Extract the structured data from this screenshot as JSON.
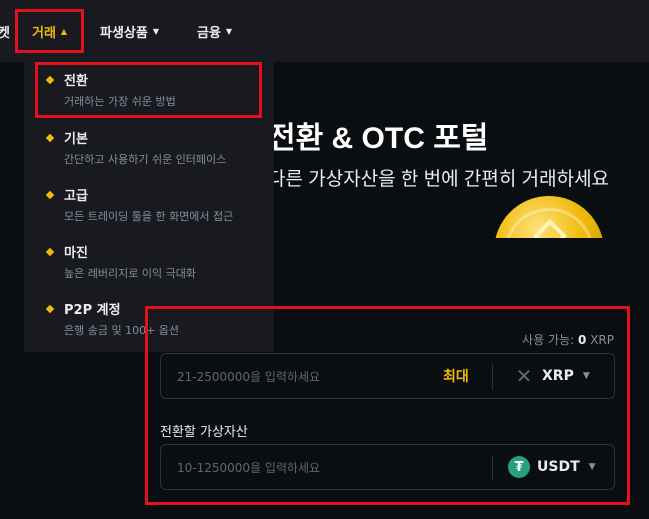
{
  "nav": {
    "fragment": "켓",
    "items": [
      {
        "label": "거래",
        "caret": "▲"
      },
      {
        "label": "파생상품",
        "caret": "▼"
      },
      {
        "label": "금융",
        "caret": "▼"
      }
    ]
  },
  "menu": {
    "items": [
      {
        "title": "전환",
        "subtitle": "거래하는 가장 쉬운 방법"
      },
      {
        "title": "기본",
        "subtitle": "간단하고 사용하기 쉬운 인터페이스"
      },
      {
        "title": "고급",
        "subtitle": "모든 트레이딩 툴을 한 화면에서 접근"
      },
      {
        "title": "마진",
        "subtitle": "높은 레버리지로 이익 극대화"
      },
      {
        "title": "P2P 계정",
        "subtitle": "은행 송금 및 100+ 옵션"
      }
    ]
  },
  "hero": {
    "title": "전환 & OTC 포털",
    "subtitle": "다른 가상자산을 한 번에 간편히 거래하세요"
  },
  "convert": {
    "available_label": "사용 가능:",
    "available_value": "0",
    "available_unit": "XRP",
    "from": {
      "placeholder": "21-2500000을 입력하세요",
      "max_label": "최대",
      "asset": "XRP",
      "asset_icon": "xrp-icon"
    },
    "to_label": "전환할 가상자산",
    "to": {
      "placeholder": "10-1250000을 입력하세요",
      "asset": "USDT",
      "asset_icon": "usdt-icon"
    }
  },
  "colors": {
    "accent": "#f0b90b",
    "highlight": "#e3101d",
    "usdt": "#26a17b"
  }
}
